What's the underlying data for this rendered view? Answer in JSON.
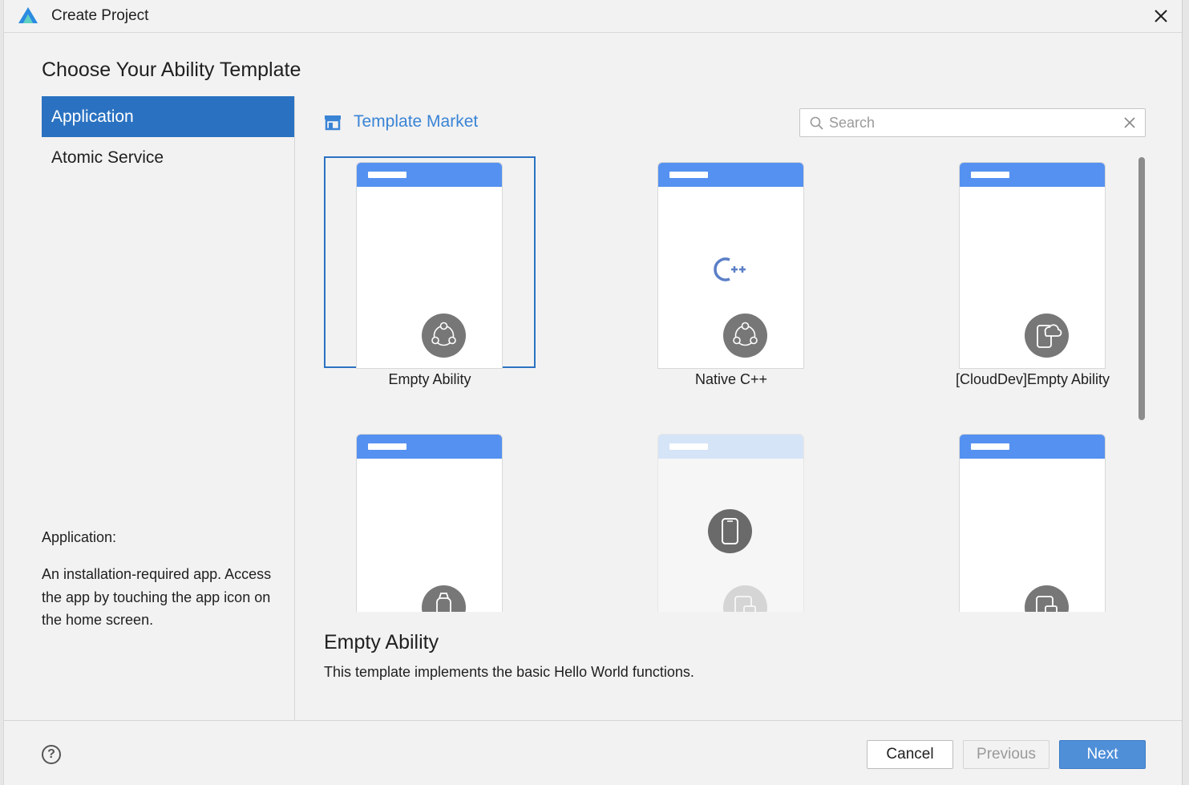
{
  "window": {
    "title": "Create Project"
  },
  "page": {
    "heading": "Choose Your Ability Template"
  },
  "nav": {
    "items": [
      {
        "label": "Application",
        "active": true
      },
      {
        "label": "Atomic Service",
        "active": false
      }
    ]
  },
  "category_description": {
    "title": "Application:",
    "body": "An installation-required app. Access the app by touching the app icon on the home screen."
  },
  "market": {
    "label": "Template Market"
  },
  "search": {
    "placeholder": "Search",
    "value": ""
  },
  "templates": [
    {
      "label": "Empty Ability",
      "selected": true,
      "badge": "ability-icon"
    },
    {
      "label": "Native C++",
      "selected": false,
      "badge": "ability-icon",
      "center_icon": "cpp-icon"
    },
    {
      "label": "[CloudDev]Empty Ability",
      "selected": false,
      "badge": "cloud-device-icon"
    },
    {
      "label": "",
      "selected": false,
      "badge": "watch-icon"
    },
    {
      "label": "",
      "selected": false,
      "badge": "device-icon",
      "center_icon": "phone-icon",
      "faded": true
    },
    {
      "label": "",
      "selected": false,
      "badge": "device-icon"
    }
  ],
  "selected_template": {
    "title": "Empty Ability",
    "description": "This template implements the basic Hello World functions."
  },
  "footer": {
    "help_icon": "?",
    "cancel_label": "Cancel",
    "previous_label": "Previous",
    "next_label": "Next"
  },
  "colors": {
    "accent": "#2a72c1",
    "phone_header": "#5591f0",
    "market_link": "#3a84d6",
    "next_button": "#4f8fd8"
  }
}
